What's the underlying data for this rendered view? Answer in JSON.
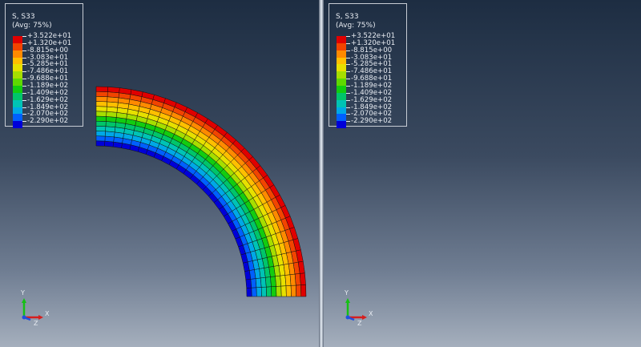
{
  "legend": {
    "title_line1": "S, S33",
    "title_line2": "(Avg: 75%)",
    "values": [
      "+3.522e+01",
      "+1.320e+01",
      "-8.815e+00",
      "-3.083e+01",
      "-5.285e+01",
      "-7.486e+01",
      "-9.688e+01",
      "-1.189e+02",
      "-1.409e+02",
      "-1.629e+02",
      "-1.849e+02",
      "-2.070e+02",
      "-2.290e+02"
    ],
    "colors": [
      "#e00000",
      "#f24400",
      "#ff8a00",
      "#ffbf00",
      "#e7e000",
      "#a6de00",
      "#5fd800",
      "#12cc10",
      "#00c56a",
      "#00c3b5",
      "#00a8e6",
      "#0060ff",
      "#0000d8"
    ]
  },
  "triad": {
    "x": "X",
    "y": "Y",
    "z": "Z"
  },
  "colors": {
    "mesh_line": "#111111",
    "viewport_top": "#1d2d42",
    "viewport_bottom": "#a5afbd"
  }
}
